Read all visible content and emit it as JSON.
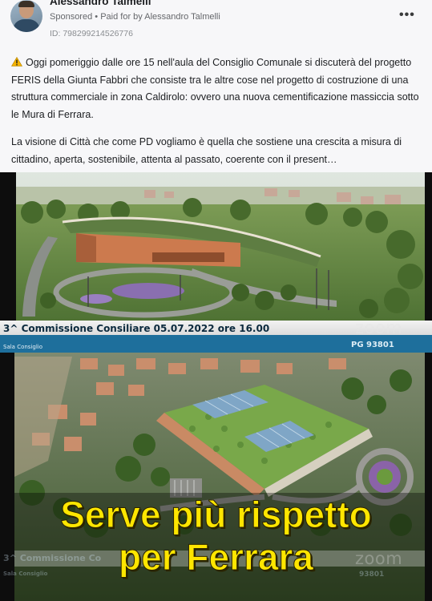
{
  "post": {
    "author": "Alessandro Talmelli",
    "sponsored": "Sponsored",
    "separator": "•",
    "paid_for_by": "Paid for by",
    "payer": "Alessandro Talmelli",
    "ad_id": "ID: 798299214526776",
    "more_icon": "•••"
  },
  "body": {
    "paragraph_1": "Oggi pomeriggio dalle ore 15 nell'aula del Consiglio Comunale si discuterà del progetto FERIS della Giunta Fabbri che consiste tra le altre cose nel progetto di costruzione di una struttura commerciale in zona Caldirolo: ovvero una nuova cementificazione massiccia sotto le Mura di Ferrara.",
    "paragraph_2": "La visione di Città che come PD vogliamo è quella che sostiene una crescita a misura di cittadino, aperta, sostenibile, attenta al passato, coerente con il present…"
  },
  "media": {
    "banner_title": "3^ Commissione Consiliare 05.07.2022 ore 16.00",
    "room_label": "Sala Consiglio",
    "pg_code": "PG 93801",
    "zoom_label": "zoom",
    "ghost_banner": "3^ Commissione Co",
    "ghost_room": "Sala Consiglio",
    "ghost_pg": "93801",
    "caption_line_1": "Serve più rispetto",
    "caption_line_2": "per Ferrara",
    "colors": {
      "caption": "#ffe600",
      "banner": "#1e6f9c",
      "banner_text": "#0c2a3e"
    }
  }
}
